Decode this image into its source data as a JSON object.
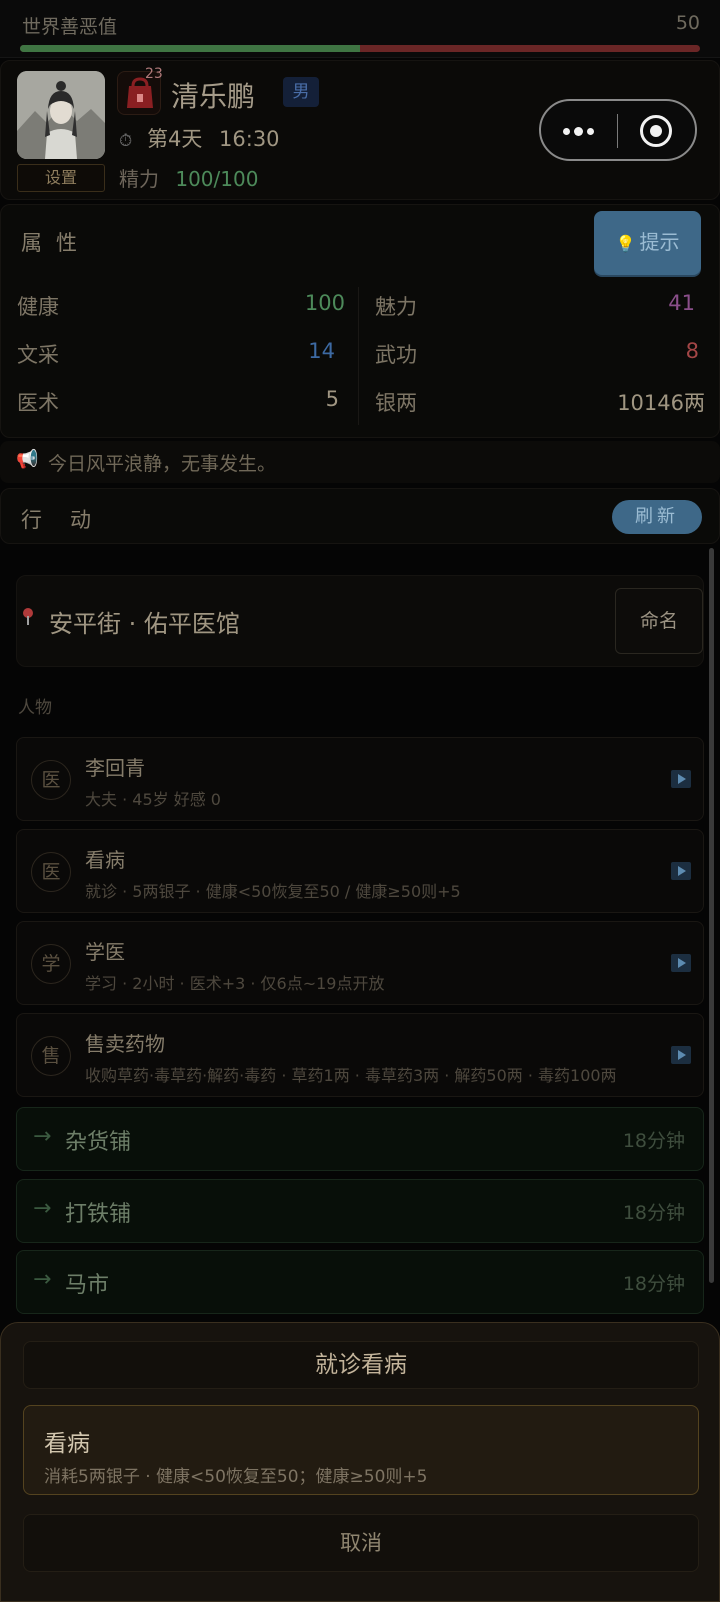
{
  "karma": {
    "label": "世界善恶值",
    "value": "50",
    "fill_fraction": 0.5
  },
  "character": {
    "name": "清乐鹏",
    "gender": "男",
    "bag_count": "23",
    "settings_label": "设置",
    "day": "第4天",
    "time": "16:30",
    "energy_label": "精力",
    "energy_value": "100/100"
  },
  "attributes": {
    "title": "属性",
    "hint_label": "提示",
    "items": [
      {
        "label": "健康",
        "value": "100",
        "color": "#4d8a5a"
      },
      {
        "label": "魅力",
        "value": "41",
        "color": "#8a4f8a"
      },
      {
        "label": "文采",
        "value": "14",
        "color": "#3d6aa3"
      },
      {
        "label": "武功",
        "value": "8",
        "color": "#a34646"
      },
      {
        "label": "医术",
        "value": "5",
        "color": "#a09682"
      },
      {
        "label": "银两",
        "value": "10146两",
        "color": "#a09682"
      }
    ]
  },
  "event": {
    "text": "今日风平浪静，无事发生。"
  },
  "actions": {
    "title": "行动",
    "refresh_label": "刷新",
    "location": "安平街 · 佑平医馆",
    "rename_label": "命名",
    "people_label": "人物",
    "entries": [
      {
        "icon": "医",
        "title": "李回青",
        "sub": "大夫 · 45岁  好感 0"
      },
      {
        "icon": "医",
        "title": "看病",
        "sub": "就诊 · 5两银子 · 健康<50恢复至50 / 健康≥50则+5"
      },
      {
        "icon": "学",
        "title": "学医",
        "sub": "学习 · 2小时 · 医术+3 · 仅6点~19点开放"
      },
      {
        "icon": "售",
        "title": "售卖药物",
        "sub": "收购草药·毒草药·解药·毒药 · 草药1两 · 毒草药3两 · 解药50两 · 毒药100两"
      }
    ],
    "travel": [
      {
        "arrow": "→",
        "name": "杂货铺",
        "time": "18分钟"
      },
      {
        "arrow": "→",
        "name": "打铁铺",
        "time": "18分钟"
      },
      {
        "arrow": "→",
        "name": "马市",
        "time": "18分钟"
      }
    ]
  },
  "sheet": {
    "title": "就诊看病",
    "option_title": "看病",
    "option_desc": "消耗5两银子 · 健康<50恢复至50；健康≥50则+5",
    "cancel_label": "取消"
  },
  "colors": {
    "accent_blue": "#3e6888",
    "karma_good": "#3f7543",
    "karma_evil": "#6a2626",
    "sheet_border": "#54431f"
  }
}
